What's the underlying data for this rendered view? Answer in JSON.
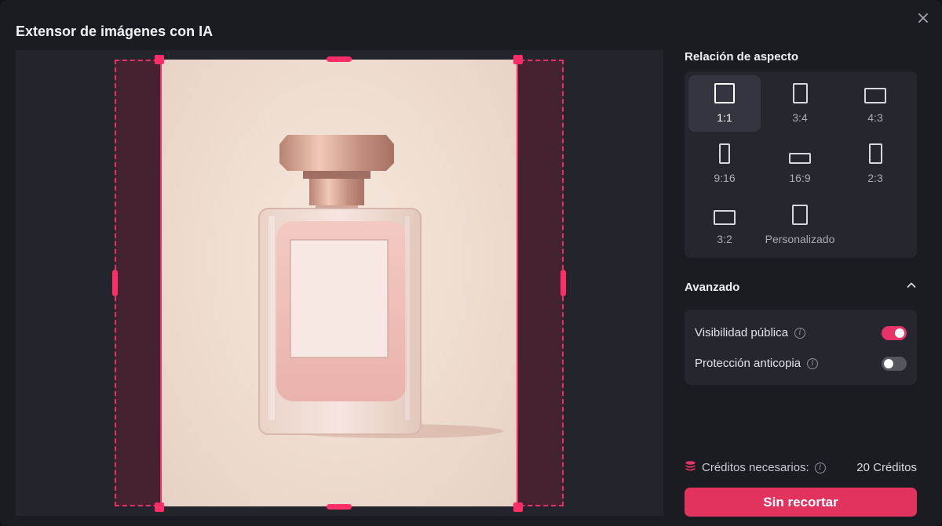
{
  "dialog": {
    "title": "Extensor de imágenes con IA",
    "close_icon": "close-icon"
  },
  "canvas": {
    "subject": "perfume bottle product photo",
    "accent_color": "#e8336a"
  },
  "aspect_ratio": {
    "title": "Relación de aspecto",
    "selected": "1:1",
    "options": [
      {
        "label": "1:1"
      },
      {
        "label": "3:4"
      },
      {
        "label": "4:3"
      },
      {
        "label": "9:16"
      },
      {
        "label": "16:9"
      },
      {
        "label": "2:3"
      },
      {
        "label": "3:2"
      },
      {
        "label": "Personalizado"
      }
    ]
  },
  "advanced": {
    "title": "Avanzado",
    "expanded": true,
    "public_visibility": {
      "label": "Visibilidad pública",
      "on": true
    },
    "copy_protection": {
      "label": "Protección anticopia",
      "on": false
    }
  },
  "credits": {
    "label": "Créditos necesarios:",
    "value": "20 Créditos"
  },
  "action": {
    "label": "Sin recortar"
  },
  "colors": {
    "accent": "#e8336a",
    "background": "#1b1c22",
    "panel": "#25262e"
  }
}
